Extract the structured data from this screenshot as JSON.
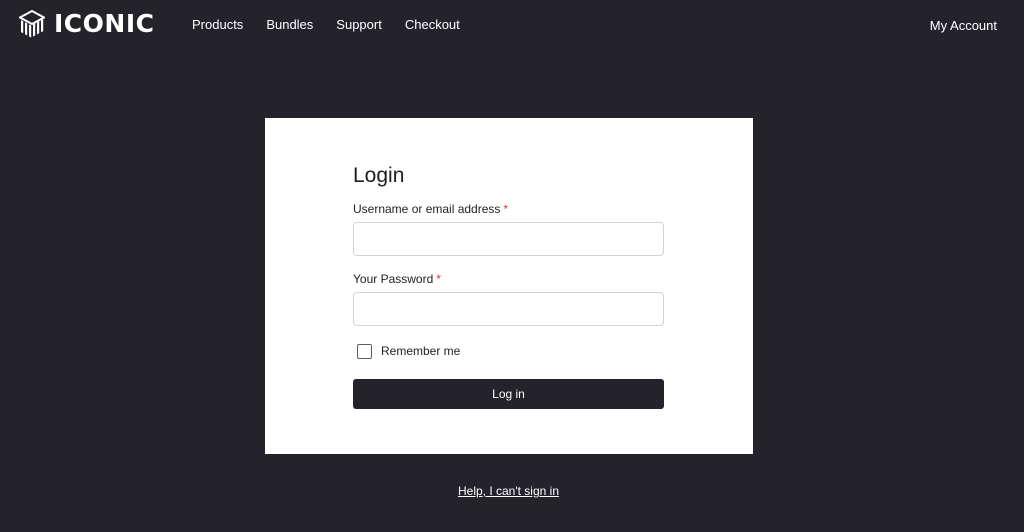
{
  "header": {
    "brand": "ICONIC",
    "logo_icon": "cube-stripes-icon",
    "nav": [
      {
        "label": "Products"
      },
      {
        "label": "Bundles"
      },
      {
        "label": "Support"
      },
      {
        "label": "Checkout"
      }
    ],
    "account_label": "My Account"
  },
  "login": {
    "title": "Login",
    "username_label": "Username or email address",
    "username_value": "",
    "password_label": "Your Password",
    "password_value": "",
    "required_marker": "*",
    "remember_label": "Remember me",
    "remember_checked": false,
    "submit_label": "Log in"
  },
  "help_link": "Help, I can't sign in",
  "colors": {
    "page_background": "#24232b",
    "card_background": "#ffffff",
    "button_background": "#24232b",
    "required_marker": "#e0352b"
  }
}
